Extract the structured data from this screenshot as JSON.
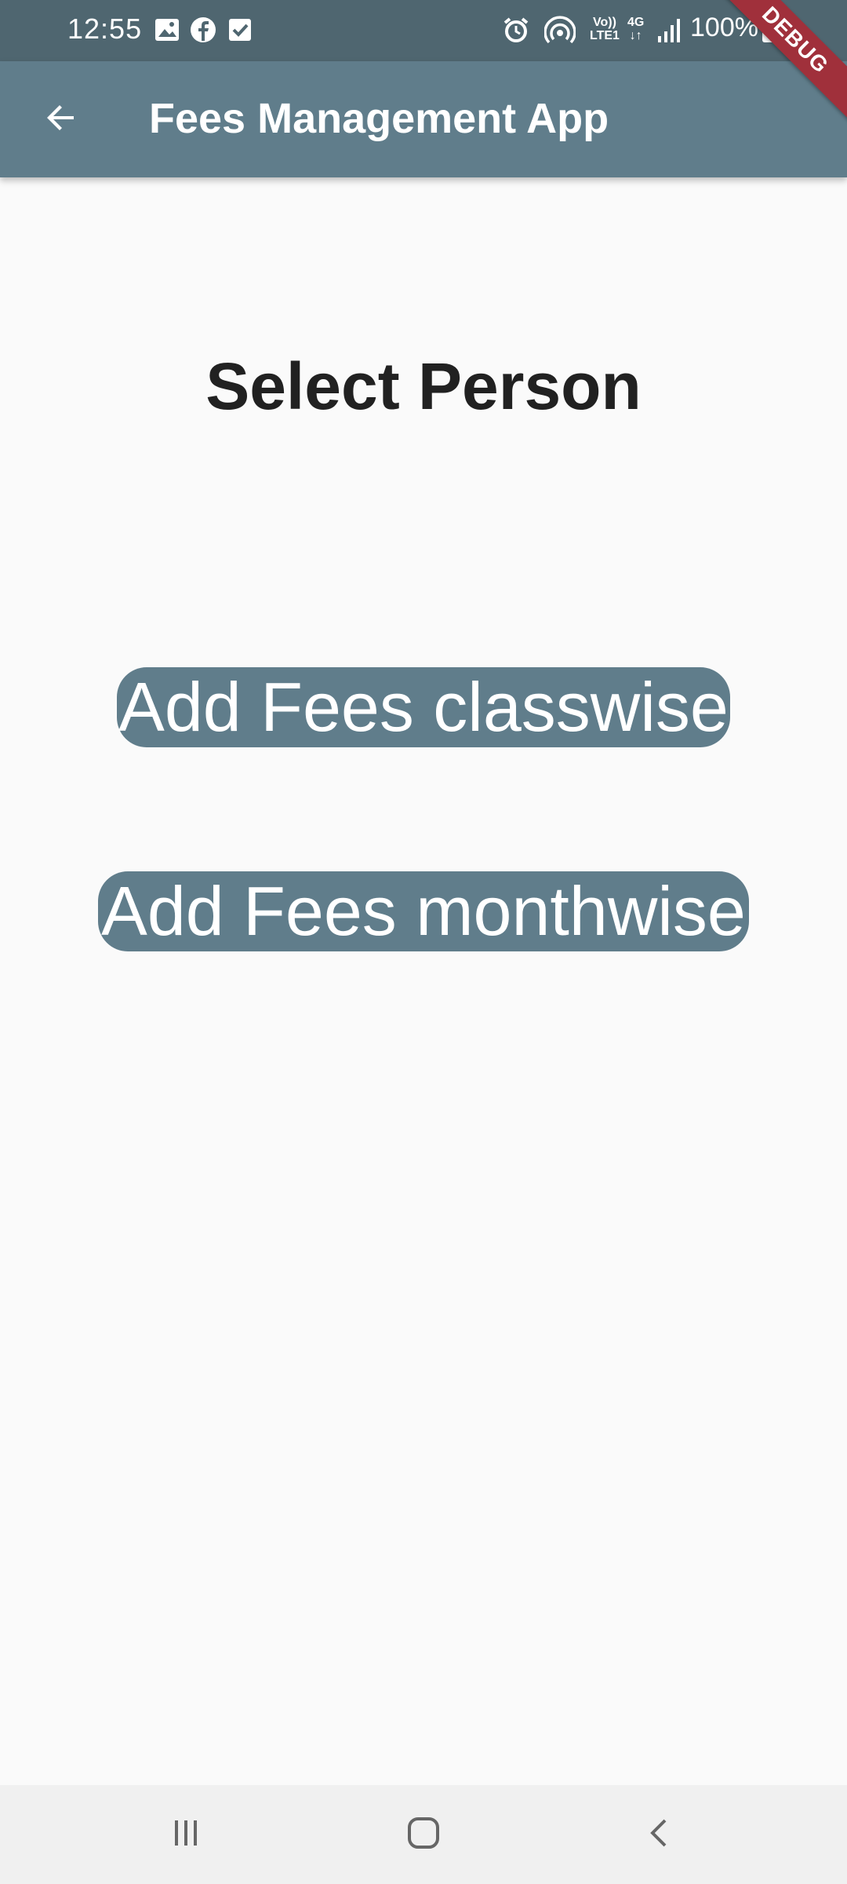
{
  "status_bar": {
    "time": "12:55",
    "network_top": "Vo))",
    "network_bottom": "LTE1",
    "network_type": "4G",
    "battery": "100%",
    "icons": [
      "image-icon",
      "facebook-icon",
      "checkbox-icon",
      "alarm-icon",
      "hotspot-icon",
      "signal-icon",
      "battery-charging-icon"
    ]
  },
  "app_bar": {
    "title": "Fees Management App",
    "back_icon": "arrow-back-icon",
    "debug_label": "DEBUG"
  },
  "main": {
    "heading": "Select Person",
    "buttons": [
      {
        "label": "Add Fees classwise"
      },
      {
        "label": "Add Fees monthwise"
      }
    ]
  },
  "nav_bar": {
    "icons": [
      "recent-apps-icon",
      "home-icon",
      "back-icon"
    ]
  },
  "colors": {
    "primary": "#607d8b",
    "status_bar": "#4f6670",
    "background": "#fafafa",
    "debug_banner": "#a0303b"
  }
}
